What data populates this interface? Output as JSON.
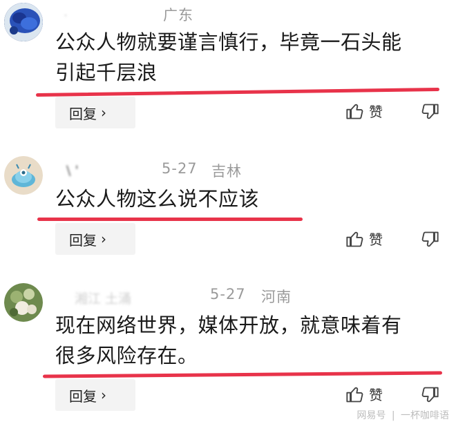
{
  "comments": [
    {
      "author_masked": "·",
      "date": "",
      "location": "广东",
      "text_lines": [
        "公众人物就要谨言慎行，毕竟一石头能",
        "引起千层浪"
      ],
      "reply_label": "回复",
      "like_label": "赞"
    },
    {
      "author_masked": "\\ '",
      "date": "5-27",
      "location": "吉林",
      "text_lines": [
        "公众人物这么说不应该"
      ],
      "reply_label": "回复",
      "like_label": "赞"
    },
    {
      "author_masked": "湘江 土涌",
      "date": "5-27",
      "location": "河南",
      "text_lines": [
        "现在网络世界，媒体开放，就意味着有",
        "很多风险存在。"
      ],
      "reply_label": "回复",
      "like_label": "赞"
    }
  ],
  "footer": {
    "source": "网易号",
    "separator": "|",
    "author": "一杯咖啡语"
  },
  "icons": {
    "like": "thumbs-up-icon",
    "dislike": "thumbs-down-icon",
    "reply_chevron": "chevron-right-icon"
  },
  "colors": {
    "highlight": "#e8334a",
    "reply_bg": "#f3f3f3",
    "meta": "#9a9a9a"
  }
}
